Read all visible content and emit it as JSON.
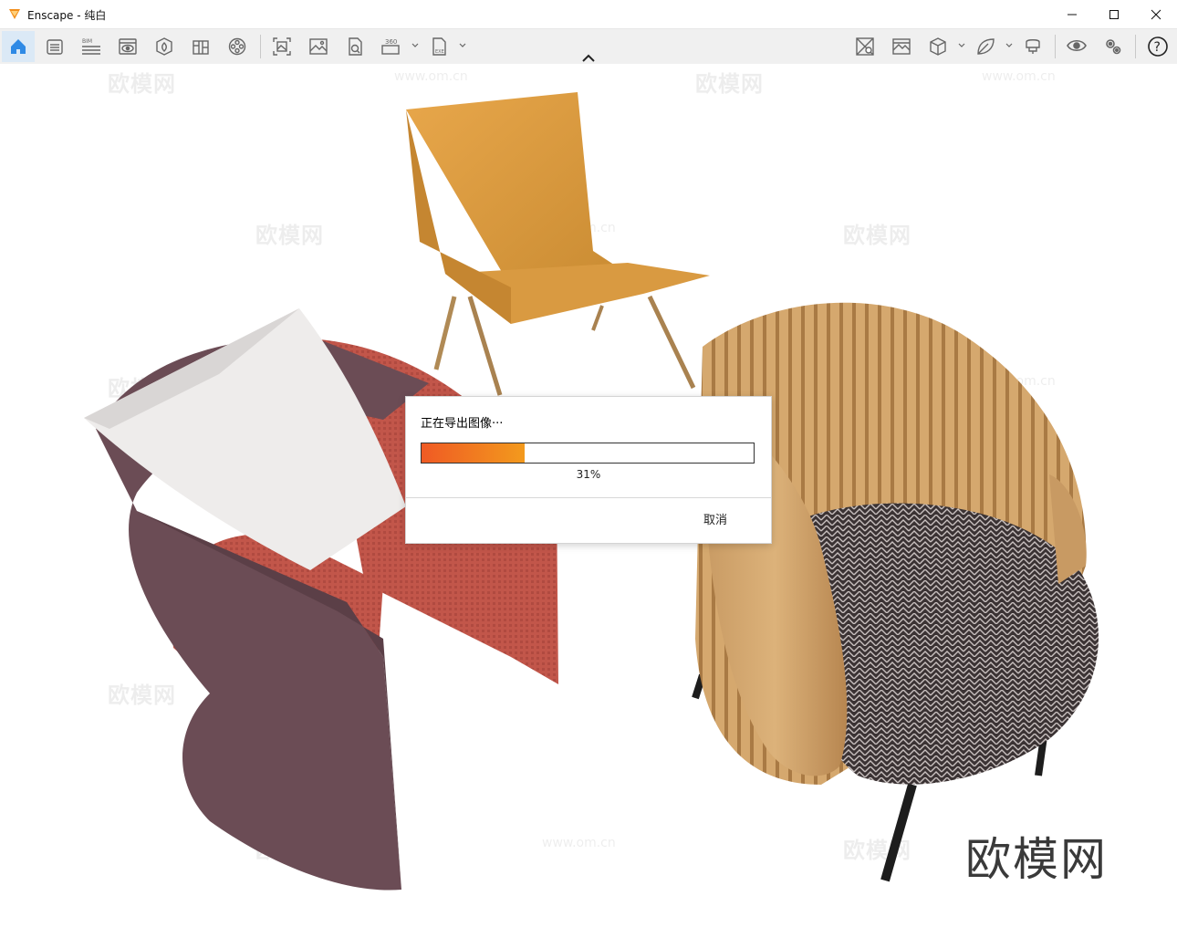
{
  "window": {
    "title": "Enscape - 纯白"
  },
  "toolbar": {
    "left_icons": [
      "home-icon",
      "settings-list-icon",
      "bim-icon",
      "views-icon",
      "assets-icon",
      "library-icon",
      "video-editor-icon",
      "screenshot-icon",
      "render-icon",
      "panorama-icon",
      "360-icon",
      "exe-export-icon"
    ],
    "right_icons": [
      "material-icon",
      "atmosphere-icon",
      "cube-icon",
      "leaf-icon",
      "vr-icon",
      "eye-icon",
      "gears-icon",
      "help-icon"
    ]
  },
  "viewport": {
    "watermark_text": "欧模网",
    "watermark_url": "www.om.cn",
    "brand_mark": "欧模网"
  },
  "export_dialog": {
    "title": "正在导出图像···",
    "progress_percent_value": 31,
    "progress_text": "31%",
    "cancel_label": "取消",
    "progress_colors": [
      "#ef5a24",
      "#f39a1d"
    ]
  },
  "colors": {
    "accent": "#2f8ae5",
    "logo": "#f28e1c"
  }
}
